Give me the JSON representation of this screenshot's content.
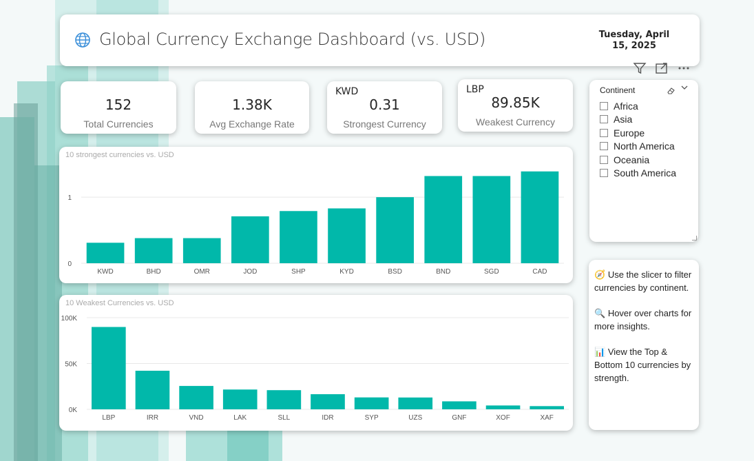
{
  "header": {
    "title": "Global Currency Exchange Dashboard (vs. USD)",
    "date": "Tuesday, April 15, 2025",
    "icon": "globe-icon"
  },
  "toolbar": {
    "icons": [
      "filter-icon",
      "focus-mode-icon",
      "more-options-icon"
    ]
  },
  "kpis": {
    "total": {
      "value": "152",
      "label": "Total Currencies"
    },
    "avg": {
      "value": "1.38K",
      "label": "Avg Exchange Rate"
    },
    "strongest": {
      "code": "KWD",
      "value": "0.31",
      "label": "Strongest Currency"
    },
    "weakest": {
      "code": "LBP",
      "value": "89.85K",
      "label": "Weakest Currency"
    }
  },
  "slicer": {
    "title": "Continent",
    "options": [
      "Africa",
      "Asia",
      "Europe",
      "North America",
      "Oceania",
      "South America"
    ]
  },
  "help": {
    "tips": [
      {
        "icon": "🧭",
        "text": "Use the slicer to filter currencies by continent."
      },
      {
        "icon": "🔍",
        "text": "Hover over charts for more insights."
      },
      {
        "icon": "📊",
        "text": "View the Top & Bottom 10 currencies by strength."
      }
    ]
  },
  "colors": {
    "bar": "#01B8AA",
    "accent": "#3b8fd9"
  },
  "chart_data": [
    {
      "type": "bar",
      "title": "10 strongest currencies vs. USD",
      "categories": [
        "KWD",
        "BHD",
        "OMR",
        "JOD",
        "SHP",
        "KYD",
        "BSD",
        "BND",
        "SGD",
        "CAD"
      ],
      "values": [
        0.31,
        0.38,
        0.38,
        0.71,
        0.79,
        0.83,
        1.0,
        1.32,
        1.32,
        1.39
      ],
      "yticks": [
        0,
        1
      ],
      "ytick_labels": [
        "0",
        "1"
      ],
      "ylim": [
        0,
        1.45
      ],
      "grid": true
    },
    {
      "type": "bar",
      "title": "10 Weakest Currencies vs. USD",
      "categories": [
        "LBP",
        "IRR",
        "VND",
        "LAK",
        "SLL",
        "IDR",
        "SYP",
        "UZS",
        "GNF",
        "XOF",
        "XAF"
      ],
      "values": [
        89850,
        42100,
        25500,
        21600,
        20900,
        16500,
        13000,
        12900,
        8700,
        4200,
        3500
      ],
      "yticks": [
        0,
        50000,
        100000
      ],
      "ytick_labels": [
        "0K",
        "50K",
        "100K"
      ],
      "ylim": [
        0,
        100000
      ],
      "grid": true
    }
  ]
}
